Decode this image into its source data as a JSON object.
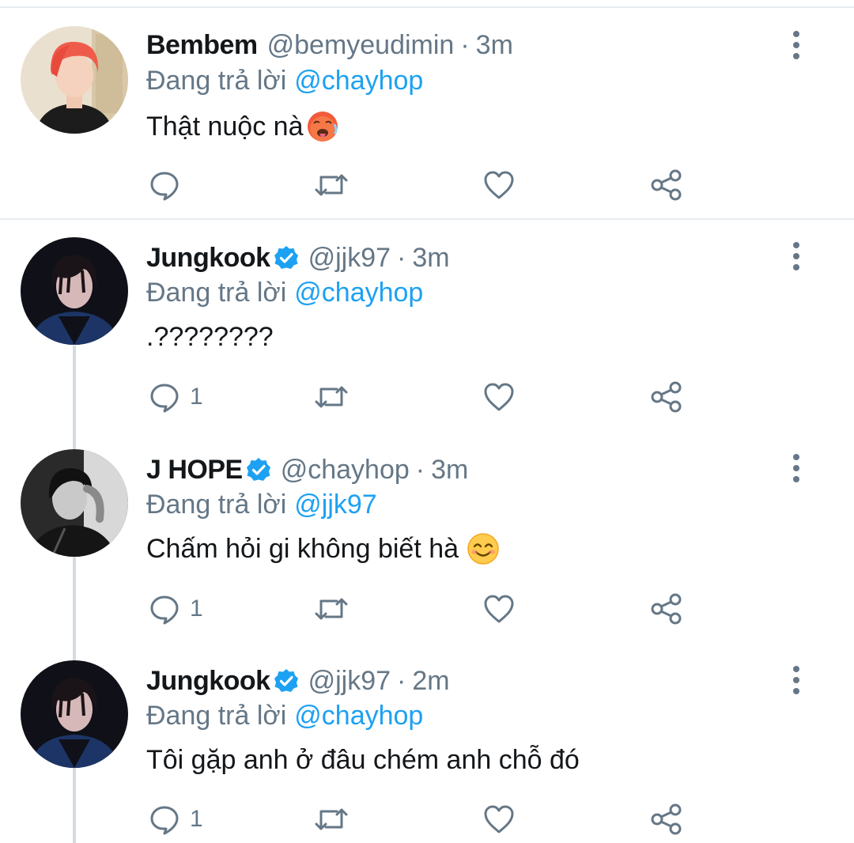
{
  "reply_prefix": "Đang trả lời",
  "tweets": [
    {
      "display_name": "Bembem",
      "verified": false,
      "handle": "@bemyeudimin",
      "separator": "·",
      "time": "3m",
      "reply_to": "@chayhop",
      "text": "Thật nuộc nà",
      "emoji": "hot-face-emoji",
      "reply_count": ""
    },
    {
      "display_name": "Jungkook",
      "verified": true,
      "handle": "@jjk97",
      "separator": "·",
      "time": "3m",
      "reply_to": "@chayhop",
      "text": ".????????",
      "emoji": "",
      "reply_count": "1"
    },
    {
      "display_name": "J HOPE",
      "verified": true,
      "handle": "@chayhop",
      "separator": "·",
      "time": "3m",
      "reply_to": "@jjk97",
      "text": "Chấm hỏi gi không biết hà",
      "emoji": "smiling-face-emoji",
      "reply_count": "1"
    },
    {
      "display_name": "Jungkook",
      "verified": true,
      "handle": "@jjk97",
      "separator": "·",
      "time": "2m",
      "reply_to": "@chayhop",
      "text": "Tôi gặp anh ở đâu chém anh chỗ đó",
      "emoji": "",
      "reply_count": "1"
    }
  ],
  "colors": {
    "text": "#14171a",
    "secondary": "#657786",
    "link": "#1da1f2",
    "divider": "#e6ecf0",
    "thread_line": "#d5dbe0"
  }
}
